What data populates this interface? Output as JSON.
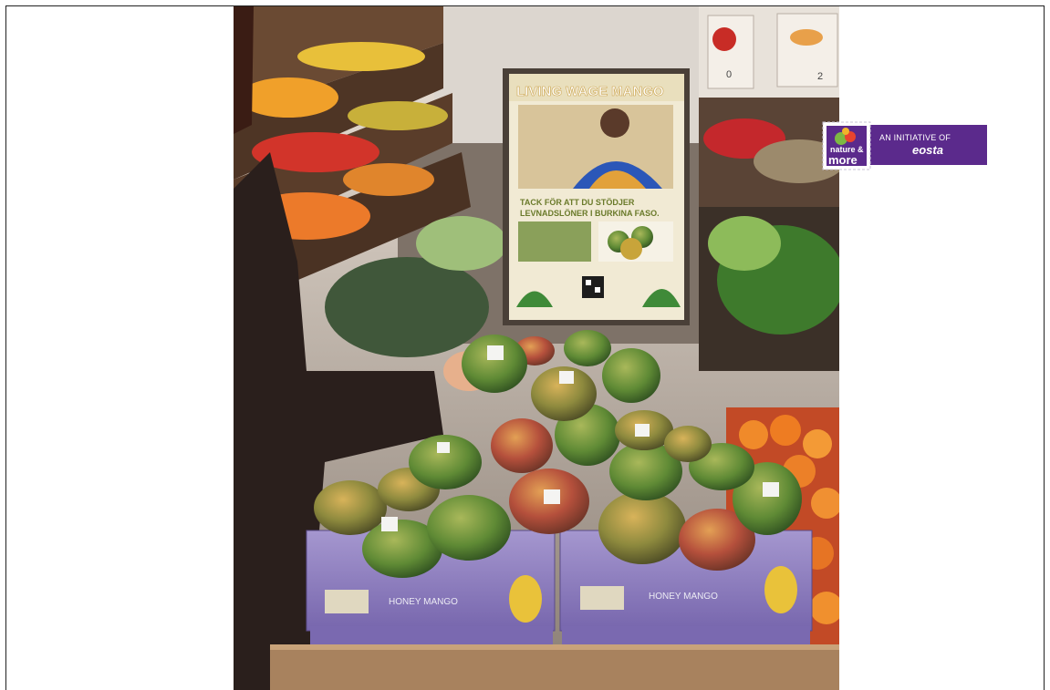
{
  "poster": {
    "title": "LIVING WAGE MANGO",
    "line1": "TACK FÖR ATT DU STÖDJER",
    "line2": "LEVNADSLÖNER I BURKINA FASO."
  },
  "boxes": {
    "label": "HONEY MANGO"
  },
  "shelf_prices": [
    "0",
    "2"
  ],
  "badge": {
    "stamp_line1": "nature &",
    "stamp_line2": "more",
    "initiative_text": "AN INITIATIVE OF",
    "brand_text": "eosta"
  },
  "colors": {
    "badge_purple": "#5b2a8c",
    "mango_green": "#6c8c3a",
    "mango_red": "#c2443a",
    "box_lilac": "#8f7cbf",
    "poster_cream": "#f1ead4"
  }
}
